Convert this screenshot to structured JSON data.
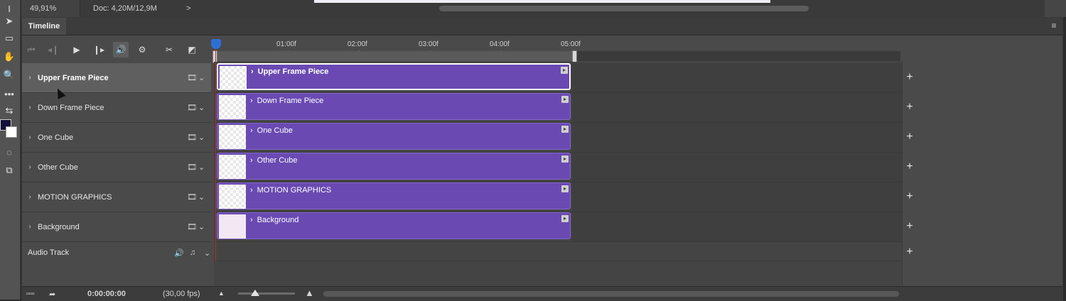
{
  "status": {
    "zoom": "49,91%",
    "doc_info": "Doc: 4,20M/12,9M",
    "arrow": ">"
  },
  "panel": {
    "tab_label": "Timeline",
    "menu_icon": "panel-menu-icon"
  },
  "controls": {
    "first_frame": "⏮",
    "prev_frame": "◂❙",
    "play": "▶",
    "next_frame": "❙▸",
    "sound": "🔊",
    "settings": "⚙",
    "split": "✂",
    "transition": "◩"
  },
  "ruler": {
    "ticks": [
      "01:00f",
      "02:00f",
      "03:00f",
      "04:00f",
      "05:00f"
    ]
  },
  "layers": [
    {
      "name": "Upper Frame Piece",
      "selected": true
    },
    {
      "name": "Down Frame Piece",
      "selected": false
    },
    {
      "name": "One Cube",
      "selected": false
    },
    {
      "name": "Other Cube",
      "selected": false
    },
    {
      "name": "MOTION GRAPHICS",
      "selected": false
    },
    {
      "name": "Background",
      "selected": false
    }
  ],
  "audio": {
    "label": "Audio Track",
    "volume_icon": "🔊",
    "note_icon": "♫"
  },
  "bottom": {
    "timecode": "0:00:00:00",
    "fps": "(30,00 fps)"
  },
  "symbols": {
    "chevron": "›",
    "film": "🎞",
    "dropdown": "⌄",
    "plus": "+",
    "clip_end": "▸"
  }
}
